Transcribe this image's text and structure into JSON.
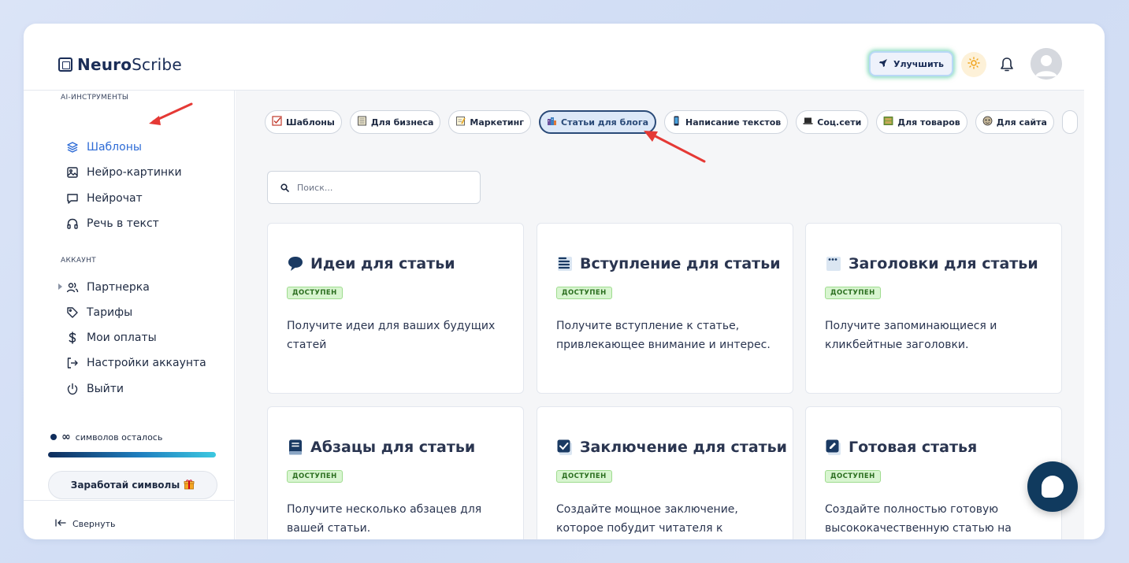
{
  "brand": {
    "bold": "Neuro",
    "regular": "Scribe"
  },
  "header": {
    "upgrade_label": "Улучшить"
  },
  "sidebar": {
    "tools_section": "AI-ИНСТРУМЕНТЫ",
    "tools": [
      {
        "label": "Шаблоны",
        "icon": "layers-icon",
        "active": true
      },
      {
        "label": "Нейро-картинки",
        "icon": "image-icon"
      },
      {
        "label": "Нейрочат",
        "icon": "chat-icon"
      },
      {
        "label": "Речь в текст",
        "icon": "headphones-icon"
      }
    ],
    "account_section": "АККАУНТ",
    "account": [
      {
        "label": "Партнерка",
        "icon": "users-icon"
      },
      {
        "label": "Тарифы",
        "icon": "tag-icon"
      },
      {
        "label": "Мои оплаты",
        "icon": "dollar-icon"
      },
      {
        "label": "Настройки аккаунта",
        "icon": "login-icon"
      },
      {
        "label": "Выйти",
        "icon": "power-icon"
      }
    ],
    "credits_value": "∞",
    "credits_label": "символов осталось",
    "earn_label": "Заработай символы",
    "collapse_label": "Свернуть"
  },
  "categories": [
    {
      "label": "Шаблоны"
    },
    {
      "label": "Для бизнеса"
    },
    {
      "label": "Маркетинг"
    },
    {
      "label": "Статьи для блога",
      "active": true
    },
    {
      "label": "Написание текстов"
    },
    {
      "label": "Соц.сети"
    },
    {
      "label": "Для товаров"
    },
    {
      "label": "Для сайта"
    }
  ],
  "search": {
    "placeholder": "Поиск..."
  },
  "cards": [
    {
      "title": "Идеи для статьи",
      "badge": "ДОСТУПЕН",
      "desc": "Получите идеи для ваших будущих статей",
      "icon": "speech-bubble-icon"
    },
    {
      "title": "Вступление для статьи",
      "badge": "ДОСТУПЕН",
      "desc": "Получите вступление к статье, привлекающее внимание и интерес.",
      "icon": "text-lines-icon"
    },
    {
      "title": "Заголовки для статьи",
      "badge": "ДОСТУПЕН",
      "desc": "Получите запоминающиеся и кликбейтные заголовки.",
      "icon": "window-icon"
    },
    {
      "title": "Абзацы для статьи",
      "badge": "ДОСТУПЕН",
      "desc": "Получите несколько абзацев для вашей статьи.",
      "icon": "book-icon"
    },
    {
      "title": "Заключение для статьи",
      "badge": "ДОСТУПЕН",
      "desc": "Создайте мощное заключение, которое побудит читателя к",
      "icon": "checkbox-icon"
    },
    {
      "title": "Готовая статья",
      "badge": "ДОСТУПЕН",
      "desc": "Создайте полностью готовую высококачественную статью на",
      "icon": "edit-icon"
    }
  ],
  "colors": {
    "accent": "#2d6bd6",
    "navy": "#103a5e",
    "badge_bg": "#d8f5d0",
    "arrow": "#e53935"
  }
}
